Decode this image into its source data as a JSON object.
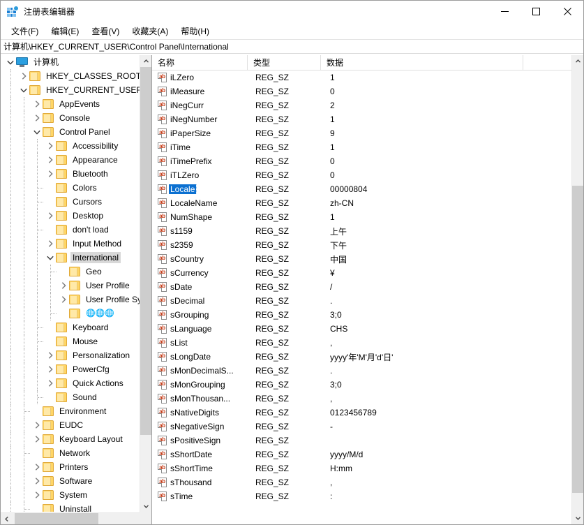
{
  "window": {
    "title": "注册表编辑器",
    "icon": "registry-editor-icon",
    "minimize_label": "最小化",
    "maximize_label": "最大化",
    "close_label": "关闭"
  },
  "menu": {
    "items": [
      {
        "label": "文件(F)",
        "name": "menu-file"
      },
      {
        "label": "编辑(E)",
        "name": "menu-edit"
      },
      {
        "label": "查看(V)",
        "name": "menu-view"
      },
      {
        "label": "收藏夹(A)",
        "name": "menu-favorites"
      },
      {
        "label": "帮助(H)",
        "name": "menu-help"
      }
    ]
  },
  "address": {
    "path": "计算机\\HKEY_CURRENT_USER\\Control Panel\\International"
  },
  "tree": {
    "rows": [
      {
        "label": "计算机",
        "depth": 0,
        "chevron": "down",
        "icon": "computer",
        "selected": false
      },
      {
        "label": "HKEY_CLASSES_ROOT",
        "depth": 1,
        "chevron": "right",
        "icon": "folder",
        "selected": false
      },
      {
        "label": "HKEY_CURRENT_USER",
        "depth": 1,
        "chevron": "down",
        "icon": "folder",
        "selected": false
      },
      {
        "label": "AppEvents",
        "depth": 2,
        "chevron": "right",
        "icon": "folder",
        "selected": false
      },
      {
        "label": "Console",
        "depth": 2,
        "chevron": "right",
        "icon": "folder",
        "selected": false
      },
      {
        "label": "Control Panel",
        "depth": 2,
        "chevron": "down",
        "icon": "folder",
        "selected": false
      },
      {
        "label": "Accessibility",
        "depth": 3,
        "chevron": "right",
        "icon": "folder",
        "selected": false
      },
      {
        "label": "Appearance",
        "depth": 3,
        "chevron": "right",
        "icon": "folder",
        "selected": false
      },
      {
        "label": "Bluetooth",
        "depth": 3,
        "chevron": "right",
        "icon": "folder",
        "selected": false
      },
      {
        "label": "Colors",
        "depth": 3,
        "chevron": "none",
        "icon": "folder",
        "selected": false
      },
      {
        "label": "Cursors",
        "depth": 3,
        "chevron": "none",
        "icon": "folder",
        "selected": false
      },
      {
        "label": "Desktop",
        "depth": 3,
        "chevron": "right",
        "icon": "folder",
        "selected": false
      },
      {
        "label": "don't load",
        "depth": 3,
        "chevron": "none",
        "icon": "folder",
        "selected": false
      },
      {
        "label": "Input Method",
        "depth": 3,
        "chevron": "right",
        "icon": "folder",
        "selected": false
      },
      {
        "label": "International",
        "depth": 3,
        "chevron": "down",
        "icon": "folder",
        "selected": true
      },
      {
        "label": "Geo",
        "depth": 4,
        "chevron": "none",
        "icon": "folder",
        "selected": false
      },
      {
        "label": "User Profile",
        "depth": 4,
        "chevron": "right",
        "icon": "folder",
        "selected": false
      },
      {
        "label": "User Profile Sys",
        "depth": 4,
        "chevron": "right",
        "icon": "folder",
        "selected": false
      },
      {
        "label": "🌐🌐🌐",
        "depth": 4,
        "chevron": "none",
        "icon": "folder",
        "selected": false
      },
      {
        "label": "Keyboard",
        "depth": 3,
        "chevron": "none",
        "icon": "folder",
        "selected": false
      },
      {
        "label": "Mouse",
        "depth": 3,
        "chevron": "none",
        "icon": "folder",
        "selected": false
      },
      {
        "label": "Personalization",
        "depth": 3,
        "chevron": "right",
        "icon": "folder",
        "selected": false
      },
      {
        "label": "PowerCfg",
        "depth": 3,
        "chevron": "right",
        "icon": "folder",
        "selected": false
      },
      {
        "label": "Quick Actions",
        "depth": 3,
        "chevron": "right",
        "icon": "folder",
        "selected": false
      },
      {
        "label": "Sound",
        "depth": 3,
        "chevron": "none",
        "icon": "folder",
        "selected": false
      },
      {
        "label": "Environment",
        "depth": 2,
        "chevron": "none",
        "icon": "folder",
        "selected": false
      },
      {
        "label": "EUDC",
        "depth": 2,
        "chevron": "right",
        "icon": "folder",
        "selected": false
      },
      {
        "label": "Keyboard Layout",
        "depth": 2,
        "chevron": "right",
        "icon": "folder",
        "selected": false
      },
      {
        "label": "Network",
        "depth": 2,
        "chevron": "none",
        "icon": "folder",
        "selected": false
      },
      {
        "label": "Printers",
        "depth": 2,
        "chevron": "right",
        "icon": "folder",
        "selected": false
      },
      {
        "label": "Software",
        "depth": 2,
        "chevron": "right",
        "icon": "folder",
        "selected": false
      },
      {
        "label": "System",
        "depth": 2,
        "chevron": "right",
        "icon": "folder",
        "selected": false
      },
      {
        "label": "Uninstall",
        "depth": 2,
        "chevron": "none",
        "icon": "folder",
        "selected": false
      }
    ]
  },
  "list": {
    "columns": [
      {
        "label": "名称",
        "name": "column-header-name"
      },
      {
        "label": "类型",
        "name": "column-header-type"
      },
      {
        "label": "数据",
        "name": "column-header-data"
      }
    ],
    "rows": [
      {
        "name": "iLZero",
        "type": "REG_SZ",
        "data": "1",
        "selected": false
      },
      {
        "name": "iMeasure",
        "type": "REG_SZ",
        "data": "0",
        "selected": false
      },
      {
        "name": "iNegCurr",
        "type": "REG_SZ",
        "data": "2",
        "selected": false
      },
      {
        "name": "iNegNumber",
        "type": "REG_SZ",
        "data": "1",
        "selected": false
      },
      {
        "name": "iPaperSize",
        "type": "REG_SZ",
        "data": "9",
        "selected": false
      },
      {
        "name": "iTime",
        "type": "REG_SZ",
        "data": "1",
        "selected": false
      },
      {
        "name": "iTimePrefix",
        "type": "REG_SZ",
        "data": "0",
        "selected": false
      },
      {
        "name": "iTLZero",
        "type": "REG_SZ",
        "data": "0",
        "selected": false
      },
      {
        "name": "Locale",
        "type": "REG_SZ",
        "data": "00000804",
        "selected": true
      },
      {
        "name": "LocaleName",
        "type": "REG_SZ",
        "data": "zh-CN",
        "selected": false
      },
      {
        "name": "NumShape",
        "type": "REG_SZ",
        "data": "1",
        "selected": false
      },
      {
        "name": "s1159",
        "type": "REG_SZ",
        "data": "上午",
        "selected": false
      },
      {
        "name": "s2359",
        "type": "REG_SZ",
        "data": "下午",
        "selected": false
      },
      {
        "name": "sCountry",
        "type": "REG_SZ",
        "data": "中国",
        "selected": false
      },
      {
        "name": "sCurrency",
        "type": "REG_SZ",
        "data": "¥",
        "selected": false
      },
      {
        "name": "sDate",
        "type": "REG_SZ",
        "data": "/",
        "selected": false
      },
      {
        "name": "sDecimal",
        "type": "REG_SZ",
        "data": ".",
        "selected": false
      },
      {
        "name": "sGrouping",
        "type": "REG_SZ",
        "data": "3;0",
        "selected": false
      },
      {
        "name": "sLanguage",
        "type": "REG_SZ",
        "data": "CHS",
        "selected": false
      },
      {
        "name": "sList",
        "type": "REG_SZ",
        "data": ",",
        "selected": false
      },
      {
        "name": "sLongDate",
        "type": "REG_SZ",
        "data": "yyyy'年'M'月'd'日'",
        "selected": false
      },
      {
        "name": "sMonDecimalS...",
        "type": "REG_SZ",
        "data": ".",
        "selected": false
      },
      {
        "name": "sMonGrouping",
        "type": "REG_SZ",
        "data": "3;0",
        "selected": false
      },
      {
        "name": "sMonThousan...",
        "type": "REG_SZ",
        "data": ",",
        "selected": false
      },
      {
        "name": "sNativeDigits",
        "type": "REG_SZ",
        "data": "0123456789",
        "selected": false
      },
      {
        "name": "sNegativeSign",
        "type": "REG_SZ",
        "data": "-",
        "selected": false
      },
      {
        "name": "sPositiveSign",
        "type": "REG_SZ",
        "data": "",
        "selected": false
      },
      {
        "name": "sShortDate",
        "type": "REG_SZ",
        "data": "yyyy/M/d",
        "selected": false
      },
      {
        "name": "sShortTime",
        "type": "REG_SZ",
        "data": "H:mm",
        "selected": false
      },
      {
        "name": "sThousand",
        "type": "REG_SZ",
        "data": ",",
        "selected": false
      },
      {
        "name": "sTime",
        "type": "REG_SZ",
        "data": ":",
        "selected": false
      }
    ]
  },
  "colors": {
    "selection_focused": "#0b70d1",
    "selection_unfocused": "#d8d8d8",
    "folder": "#ffd666",
    "accent": "#1a7fd4"
  }
}
